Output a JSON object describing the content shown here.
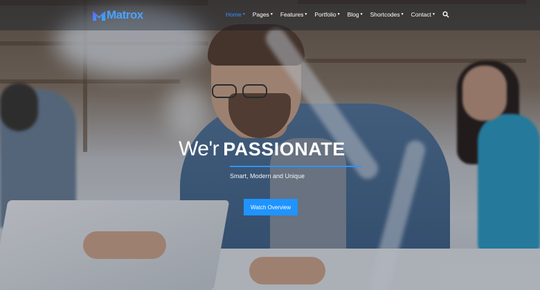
{
  "brand": {
    "name": "Matrox",
    "accent": "#2f94ff"
  },
  "nav": {
    "items": [
      {
        "label": "Home",
        "active": true,
        "has_dropdown": true
      },
      {
        "label": "Pages",
        "active": false,
        "has_dropdown": true
      },
      {
        "label": "Features",
        "active": false,
        "has_dropdown": true
      },
      {
        "label": "Portfolio",
        "active": false,
        "has_dropdown": true
      },
      {
        "label": "Blog",
        "active": false,
        "has_dropdown": true
      },
      {
        "label": "Shortcodes",
        "active": false,
        "has_dropdown": true
      },
      {
        "label": "Contact",
        "active": false,
        "has_dropdown": true
      }
    ],
    "search_icon": "search-icon"
  },
  "hero": {
    "headline_light": "We'r",
    "headline_bold": "PASSIONATE",
    "subtitle": "Smart, Modern and Unique",
    "cta_label": "Watch Overview"
  }
}
